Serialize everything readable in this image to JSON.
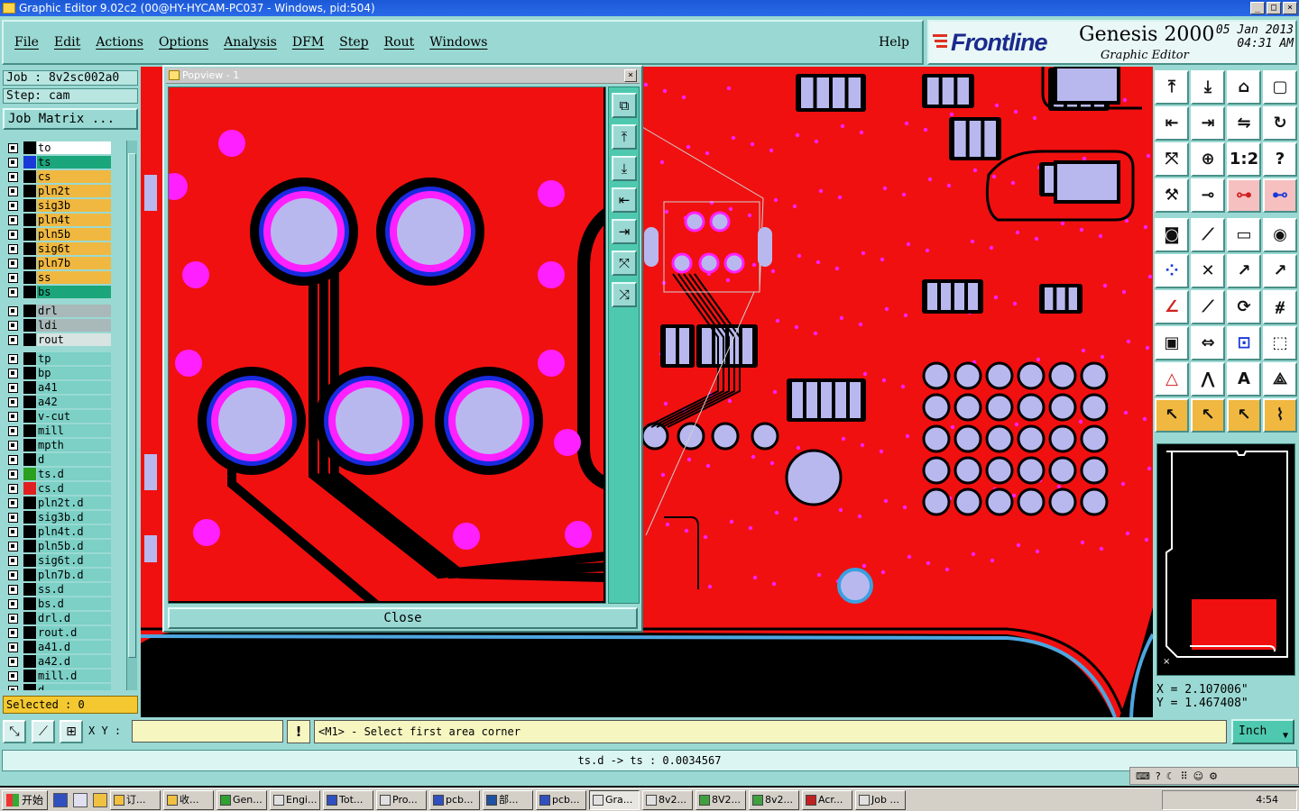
{
  "window": {
    "title": "Graphic Editor 9.02c2 (00@HY-HYCAM-PC037 - Windows, pid:504)",
    "buttons": [
      "_",
      "□",
      "×"
    ]
  },
  "menu": {
    "items": [
      "File",
      "Edit",
      "Actions",
      "Options",
      "Analysis",
      "DFM",
      "Step",
      "Rout",
      "Windows"
    ],
    "help": "Help"
  },
  "brand": {
    "logo": "Frontline",
    "product": "Genesis 2000",
    "subtitle": "Graphic Editor",
    "date": "05 Jan 2013",
    "time": "04:31 AM"
  },
  "job": {
    "job_label": "Job : 8v2sc002a0",
    "step_label": "Step: cam",
    "matrix_button": "Job Matrix ..."
  },
  "layers": {
    "group1": [
      {
        "name": "to",
        "color": "#ffffff",
        "swatch": "#000000"
      },
      {
        "name": "ts",
        "color": "#1aa67a",
        "swatch": "#1a3ad8",
        "mark": "✎"
      },
      {
        "name": "cs",
        "color": "#f0b840",
        "swatch": "#000000"
      },
      {
        "name": "pln2t",
        "color": "#f0b840",
        "swatch": "#000000"
      },
      {
        "name": "sig3b",
        "color": "#f0b840",
        "swatch": "#000000"
      },
      {
        "name": "pln4t",
        "color": "#f0b840",
        "swatch": "#000000"
      },
      {
        "name": "pln5b",
        "color": "#f0b840",
        "swatch": "#000000"
      },
      {
        "name": "sig6t",
        "color": "#f0b840",
        "swatch": "#000000"
      },
      {
        "name": "pln7b",
        "color": "#f0b840",
        "swatch": "#000000"
      },
      {
        "name": "ss",
        "color": "#f0b840",
        "swatch": "#000000"
      },
      {
        "name": "bs",
        "color": "#1aa67a",
        "swatch": "#000000",
        "mark": "✎"
      }
    ],
    "group2": [
      {
        "name": "drl",
        "color": "#a9b8b8",
        "swatch": "#000000"
      },
      {
        "name": "ldi",
        "color": "#a9b8b8",
        "swatch": "#000000"
      },
      {
        "name": "rout",
        "color": "#d8e4e2",
        "swatch": "#000000"
      }
    ],
    "group3": [
      {
        "name": "tp",
        "color": "#7cd0c6",
        "swatch": "#000000"
      },
      {
        "name": "bp",
        "color": "#7cd0c6",
        "swatch": "#000000"
      },
      {
        "name": "a41",
        "color": "#7cd0c6",
        "swatch": "#000000"
      },
      {
        "name": "a42",
        "color": "#7cd0c6",
        "swatch": "#000000"
      },
      {
        "name": "v-cut",
        "color": "#7cd0c6",
        "swatch": "#000000"
      },
      {
        "name": "mill",
        "color": "#7cd0c6",
        "swatch": "#000000"
      },
      {
        "name": "mpth",
        "color": "#7cd0c6",
        "swatch": "#000000"
      },
      {
        "name": "d",
        "color": "#7cd0c6",
        "swatch": "#000000"
      },
      {
        "name": "ts.d",
        "color": "#7cd0c6",
        "swatch": "#2aa020",
        "mark": "✎⊞"
      },
      {
        "name": "cs.d",
        "color": "#7cd0c6",
        "swatch": "#e02020"
      },
      {
        "name": "pln2t.d",
        "color": "#7cd0c6",
        "swatch": "#000000"
      },
      {
        "name": "sig3b.d",
        "color": "#7cd0c6",
        "swatch": "#000000"
      },
      {
        "name": "pln4t.d",
        "color": "#7cd0c6",
        "swatch": "#000000"
      },
      {
        "name": "pln5b.d",
        "color": "#7cd0c6",
        "swatch": "#000000"
      },
      {
        "name": "sig6t.d",
        "color": "#7cd0c6",
        "swatch": "#000000"
      },
      {
        "name": "pln7b.d",
        "color": "#7cd0c6",
        "swatch": "#000000"
      },
      {
        "name": "ss.d",
        "color": "#7cd0c6",
        "swatch": "#000000"
      },
      {
        "name": "bs.d",
        "color": "#7cd0c6",
        "swatch": "#000000",
        "mark": "✎"
      },
      {
        "name": "drl.d",
        "color": "#7cd0c6",
        "swatch": "#000000"
      },
      {
        "name": "rout.d",
        "color": "#7cd0c6",
        "swatch": "#000000"
      },
      {
        "name": "a41.d",
        "color": "#7cd0c6",
        "swatch": "#000000"
      },
      {
        "name": "a42.d",
        "color": "#7cd0c6",
        "swatch": "#000000"
      },
      {
        "name": "mill.d",
        "color": "#7cd0c6",
        "swatch": "#000000"
      },
      {
        "name": "d",
        "color": "#7cd0c6",
        "swatch": "#000000"
      }
    ]
  },
  "selected_label": "Selected : 0",
  "popview": {
    "title": "Popview - 1",
    "close_label": "Close",
    "tools": [
      "zoom-home-icon",
      "zoom-in-icon",
      "zoom-out-icon",
      "pan-left-icon",
      "pan-right-icon",
      "zoom-fit-icon",
      "zoom-area-icon"
    ]
  },
  "coords": {
    "x": "X = 2.107006\"",
    "y": "Y = 1.467408\""
  },
  "command": {
    "xy_label": "X Y :",
    "input_value": "",
    "excl": "!",
    "prompt": "<M1> - Select first area corner",
    "units": "Inch"
  },
  "status": {
    "text": "ts.d -> ts : 0.0034567"
  },
  "taskbar": {
    "start": "开始",
    "tasks": [
      "订...",
      "收...",
      "Gen...",
      "Engi...",
      "Tot...",
      "Pro...",
      "pcb...",
      "部...",
      "pcb...",
      "Gra...",
      "8v2...",
      "8V2...",
      "8v2...",
      "Acr...",
      "Job ..."
    ],
    "active_index": 9,
    "clock": "4:54"
  },
  "colors": {
    "panel": "#9ad9d3",
    "board": "#f01010",
    "pad": "#b8b8ef",
    "via": "#ff20ff",
    "accent": "#4ec9af"
  }
}
